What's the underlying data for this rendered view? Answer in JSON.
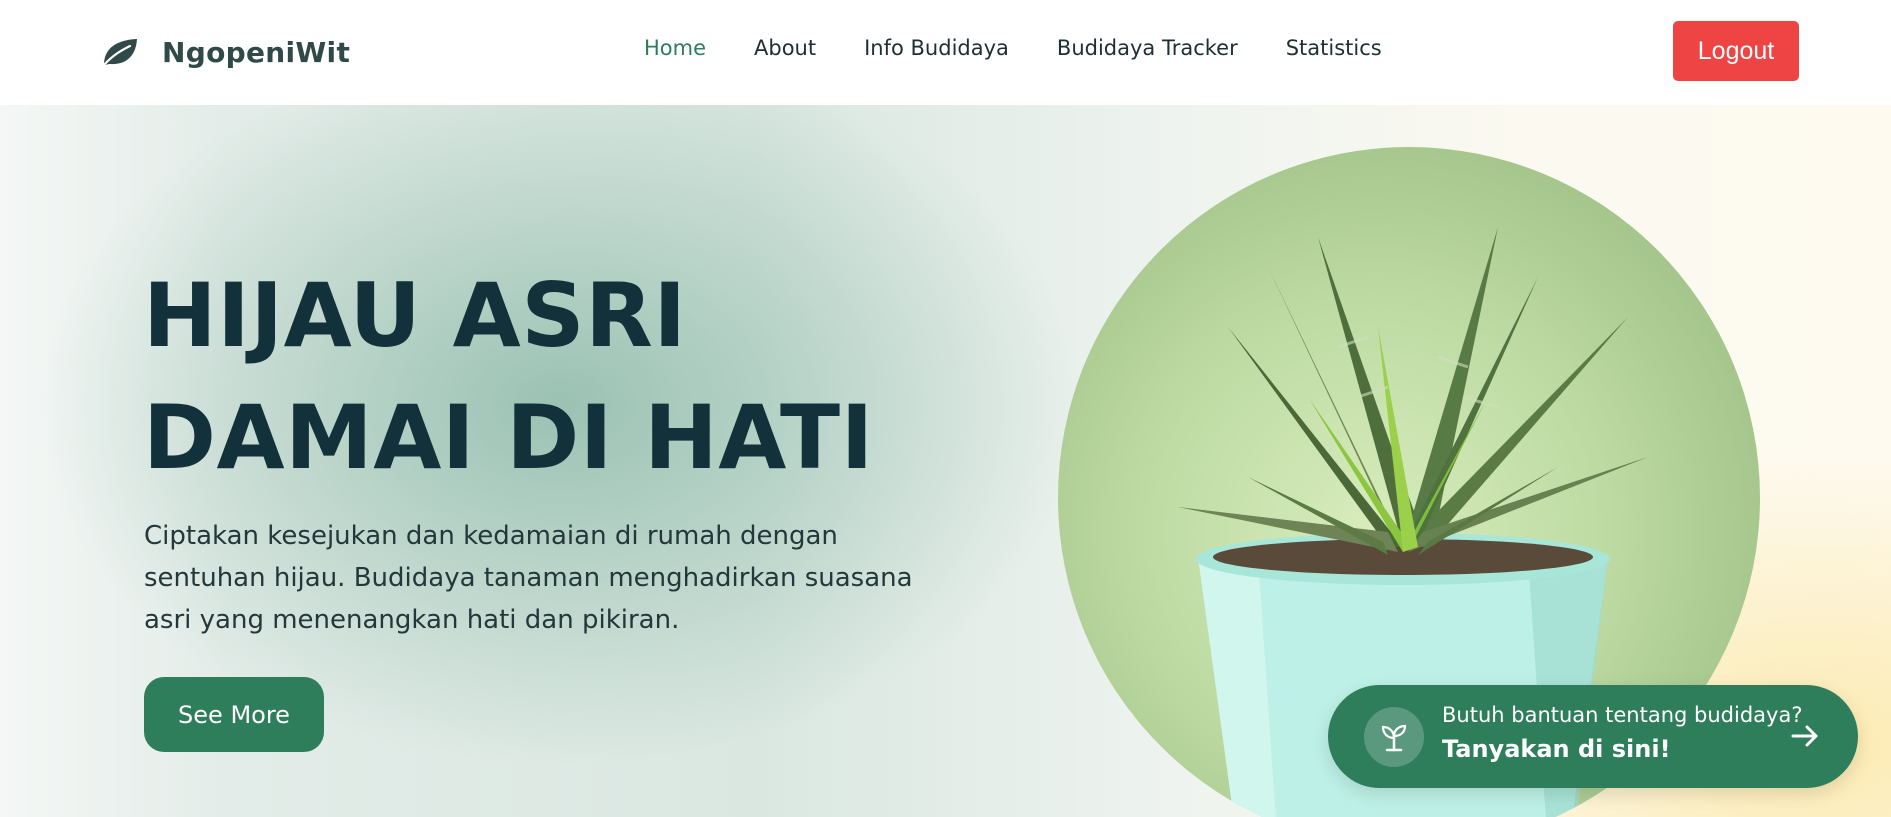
{
  "navbar": {
    "brand_name": "NgopeniWit",
    "brand_icon": "leaf-icon",
    "links": [
      {
        "label": "Home",
        "active": true
      },
      {
        "label": "About",
        "active": false
      },
      {
        "label": "Info Budidaya",
        "active": false
      },
      {
        "label": "Budidaya Tracker",
        "active": false
      },
      {
        "label": "Statistics",
        "active": false
      }
    ],
    "logout_label": "Logout"
  },
  "hero": {
    "title_line1": "HIJAU ASRI",
    "title_line2": "DAMAI DI HATI",
    "description": "Ciptakan kesejukan dan kedamaian di rumah dengan sentuhan hijau. Budidaya tanaman menghadirkan suasana asri yang menenangkan hati dan pikiran.",
    "cta_label": "See More",
    "image_subject": "potted-succulent-plant"
  },
  "help_chat": {
    "icon": "sprout-icon",
    "line1": "Butuh bantuan tentang budidaya?",
    "line2": "Tanyakan di sini!",
    "arrow_icon": "arrow-right-icon"
  },
  "colors": {
    "primary_green": "#2e7d5b",
    "active_nav": "#2e7d5b",
    "logout_red": "#ef4444",
    "title_dark": "#12313a",
    "pot_mint": "#bdf0e6"
  }
}
